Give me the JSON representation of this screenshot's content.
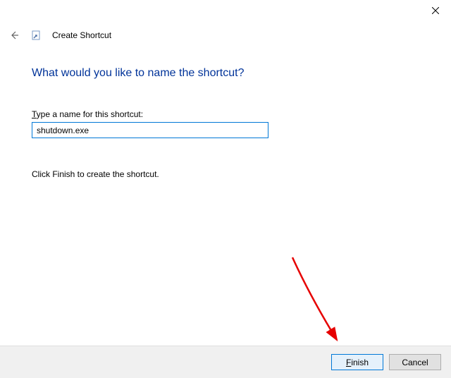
{
  "window": {
    "title": "Create Shortcut"
  },
  "page": {
    "heading": "What would you like to name the shortcut?",
    "field_label_prefix": "T",
    "field_label_rest": "ype a name for this shortcut:",
    "instruction": "Click Finish to create the shortcut."
  },
  "input": {
    "value": "shutdown.exe"
  },
  "buttons": {
    "finish_prefix": "F",
    "finish_rest": "inish",
    "cancel": "Cancel"
  }
}
